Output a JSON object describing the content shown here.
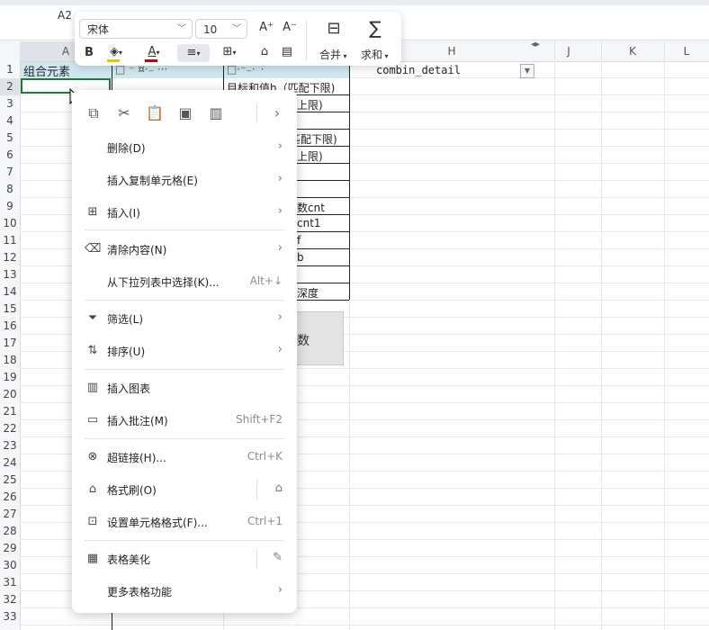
{
  "name_box": "A2",
  "columns": {
    "A": "A",
    "H": "H",
    "J": "J",
    "K": "K",
    "L": "L"
  },
  "rows": [
    "1",
    "2",
    "3",
    "4",
    "5",
    "6",
    "7",
    "8",
    "9",
    "10",
    "11",
    "12",
    "13",
    "14",
    "15",
    "16",
    "17",
    "18",
    "19",
    "20",
    "21",
    "22",
    "23",
    "24",
    "25",
    "26",
    "27",
    "28",
    "29",
    "30",
    "31",
    "32",
    "33"
  ],
  "cells": {
    "A1": "组合元素",
    "B1_partial": "□ ⁻ ¤·₋ ···",
    "C1_partial": "□·⁻₋·¨·",
    "G1": "combin_detail",
    "G2": "目标和值h（匹配下限)",
    "G3": "上限)",
    "G5": "匹配下限)",
    "G6": "上限)",
    "G9": "数cnt",
    "G10": "cnt1",
    "G11": "f",
    "G12": "b",
    "G14": "深度",
    "shape": "数"
  },
  "toolbar": {
    "font_name": "宋体",
    "font_size": "10",
    "increase_font": "A⁺",
    "decrease_font": "A⁻",
    "bold": "B",
    "merge_label": "合并",
    "sum_label": "求和"
  },
  "menu": {
    "delete": "删除(D)",
    "insert_copied": "插入复制单元格(E)",
    "insert": "插入(I)",
    "clear": "清除内容(N)",
    "pick_list": "从下拉列表中选择(K)...",
    "pick_list_shortcut": "Alt+↓",
    "filter": "筛选(L)",
    "sort": "排序(U)",
    "insert_chart": "插入图表",
    "insert_comment": "插入批注(M)",
    "insert_comment_shortcut": "Shift+F2",
    "hyperlink": "超链接(H)...",
    "hyperlink_shortcut": "Ctrl+K",
    "format_painter": "格式刷(O)",
    "format_cells": "设置单元格格式(F)...",
    "format_cells_shortcut": "Ctrl+1",
    "beautify": "表格美化",
    "more": "更多表格功能"
  },
  "colors": {
    "header_fill": "#cfe8ef",
    "selection": "#1e7a3b",
    "font_color": "#c00000",
    "fill_color": "#f2c200"
  }
}
